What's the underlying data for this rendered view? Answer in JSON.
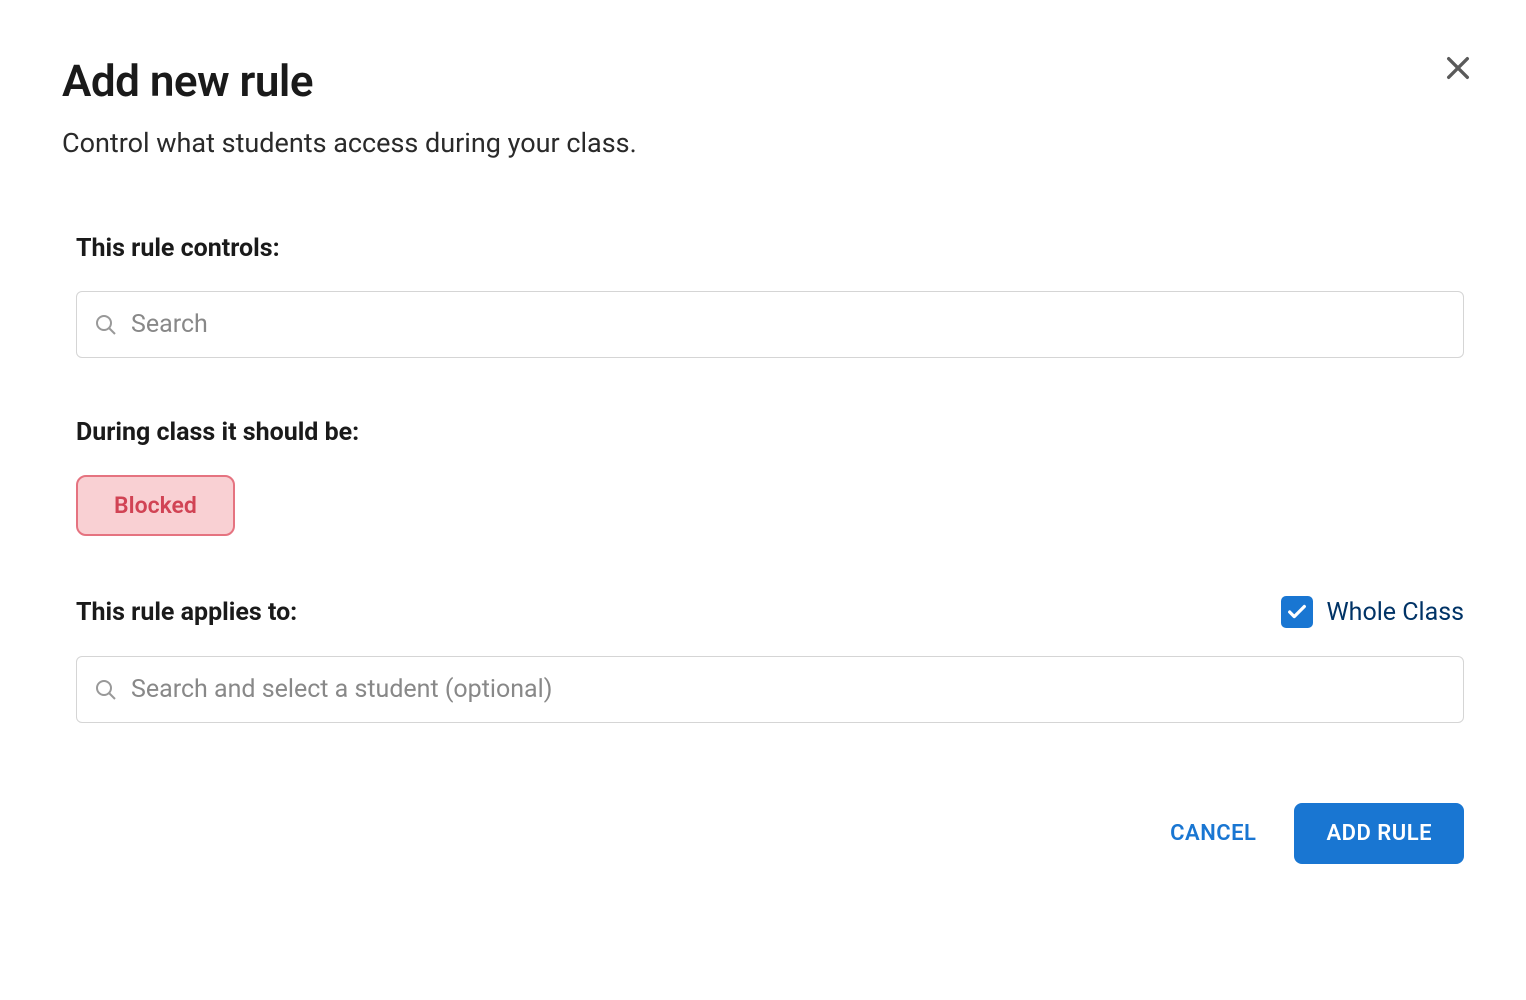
{
  "modal": {
    "title": "Add new rule",
    "subtitle": "Control what students access during your class."
  },
  "sections": {
    "controls": {
      "label": "This rule controls:",
      "placeholder": "Search"
    },
    "during": {
      "label": "During class it should be:",
      "chip": "Blocked"
    },
    "applies": {
      "label": "This rule applies to:",
      "checkbox_label": "Whole Class",
      "checked": true,
      "placeholder": "Search and select a student (optional)"
    }
  },
  "footer": {
    "cancel": "CANCEL",
    "add_rule": "ADD RULE"
  }
}
